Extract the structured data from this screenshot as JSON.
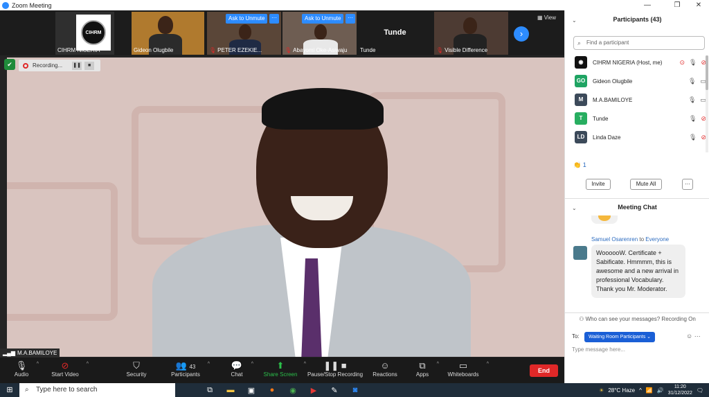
{
  "window": {
    "title": "Zoom Meeting"
  },
  "gallery": {
    "tiles": [
      {
        "name": "CIHRM NIGERIA",
        "logo_text": "CIHRM",
        "muted": false
      },
      {
        "name": "Gideon Olugbile",
        "muted": false
      },
      {
        "name": "PETER EZEKIE...",
        "muted": true,
        "ask": "Ask to Unmute"
      },
      {
        "name": "Abayomi Oke-Asiwaju",
        "muted": true,
        "ask": "Ask to Unmute"
      },
      {
        "name": "Tunde",
        "center": "Tunde",
        "muted": false
      },
      {
        "name": "Visible Difference",
        "muted": true
      }
    ],
    "view_label": "View",
    "more_label": "···"
  },
  "recording": {
    "label": "Recording..."
  },
  "speaker": {
    "name": "M.A.BAMILOYE"
  },
  "toolbar": {
    "audio": "Audio",
    "video": "Start Video",
    "security": "Security",
    "participants": "Participants",
    "participants_count": "43",
    "chat": "Chat",
    "share": "Share Screen",
    "record": "Pause/Stop Recording",
    "reactions": "Reactions",
    "apps": "Apps",
    "whiteboards": "Whiteboards",
    "end": "End"
  },
  "participants_panel": {
    "title": "Participants (43)",
    "search_placeholder": "Find a participant",
    "rows": [
      {
        "initials": "",
        "name": "CIHRM NIGERIA (Host, me)",
        "color": "#111111"
      },
      {
        "initials": "GO",
        "name": "Gideon Olugbile",
        "color": "#1fa463"
      },
      {
        "initials": "M",
        "name": "M.A.BAMILOYE",
        "color": "#3c4a5a"
      },
      {
        "initials": "T",
        "name": "Tunde",
        "color": "#27ae60"
      },
      {
        "initials": "LD",
        "name": "Linda Daze",
        "color": "#3c4a5a"
      }
    ],
    "reaction_count": "1",
    "invite": "Invite",
    "mute_all": "Mute All",
    "more": "···"
  },
  "chat": {
    "title": "Meeting Chat",
    "sender": "Samuel Osarenren",
    "to_word": "to",
    "recipient": "Everyone",
    "message": "WoooooW. Certificate + Sabificate. Hmmmm, this is awesome and a new arrival in professional Vocabulary. Thank you Mr. Moderator.",
    "who_can_see": "Who can see your messages? Recording On",
    "to_label": "To:",
    "to_value": "Waiting Room Participants",
    "input_placeholder": "Type message here..."
  },
  "taskbar": {
    "search_placeholder": "Type here to search",
    "weather": "28°C  Haze",
    "time": "11:20",
    "date": "31/12/2022"
  }
}
